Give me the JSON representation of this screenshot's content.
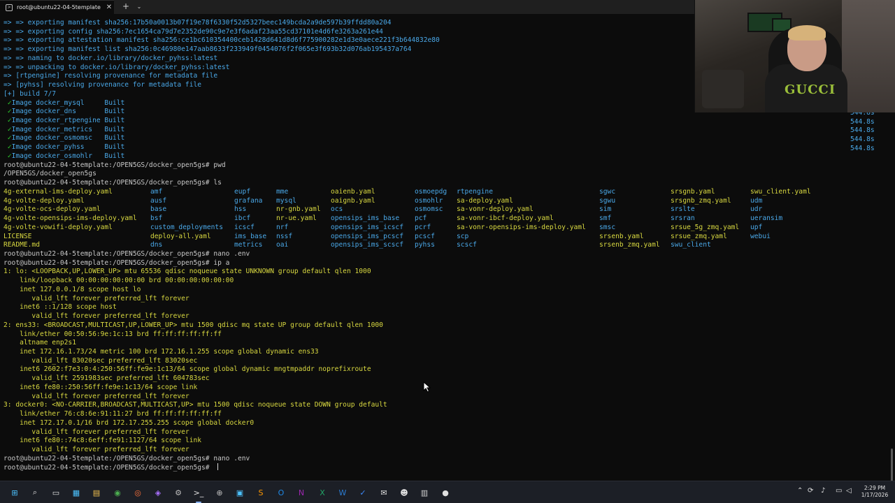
{
  "window": {
    "tab_title": "root@ubuntu22-04-5template",
    "tab_icon": "terminal-icon",
    "close_glyph": "✕",
    "new_tab_glyph": "+",
    "dropdown_glyph": "⌄"
  },
  "colors": {
    "background": "#0c0c0c",
    "text": "#c8c8c8",
    "blue": "#4aa8e8",
    "green": "#1cc41c",
    "yellow": "#d8d840"
  },
  "build_output": [
    {
      "arrow": "=> => ",
      "text": "exporting manifest sha256:17b50a0013b07f19e78f6330f52d5327beec149bcda2a9de597b39ffdd80a204"
    },
    {
      "arrow": "=> => ",
      "text": "exporting config sha256:7ec1654ca79d7e2352de90c9e7e3f6adaf23aa55cd37101e4d6fe3263a261e44"
    },
    {
      "arrow": "=> => ",
      "text": "exporting attestation manifest sha256:ce1bc610354400ceb1428d641d8d6f775900282e1d3e0aece221f3b644832e80"
    },
    {
      "arrow": "=> => ",
      "text": "exporting manifest list sha256:0c46980e147aab8633f233949f0454076f2f065e3f693b32d076ab195437a764"
    },
    {
      "arrow": "=> => ",
      "text": "naming to docker.io/library/docker_pyhss:latest"
    },
    {
      "arrow": "=> => ",
      "text": "unpacking to docker.io/library/docker_pyhss:latest"
    },
    {
      "arrow": "=> ",
      "text": "[rtpengine] resolving provenance for metadata file"
    },
    {
      "arrow": "=> ",
      "text": "[pyhss] resolving provenance for metadata file"
    }
  ],
  "build_summary": "[+] build 7/7",
  "images": [
    {
      "name": "Image docker_mysql",
      "status": "Built"
    },
    {
      "name": "Image docker_dns",
      "status": "Built"
    },
    {
      "name": "Image docker_rtpengine",
      "status": "Built"
    },
    {
      "name": "Image docker_metrics",
      "status": "Built"
    },
    {
      "name": "Image docker_osmomsc",
      "status": "Built"
    },
    {
      "name": "Image docker_pyhss",
      "status": "Built"
    },
    {
      "name": "Image docker_osmohlr",
      "status": "Built"
    }
  ],
  "check_glyph": "✓",
  "build_times": [
    "544.8s",
    "544.8s",
    "544.8s",
    "544.8s",
    "544.8s",
    "544.8s",
    "544.8s"
  ],
  "prompt": "root@ubuntu22-04-5template:/OPEN5GS/docker_open5gs#",
  "commands": {
    "pwd": "pwd",
    "pwd_output": "/OPEN5GS/docker_open5gs",
    "ls": "ls",
    "nano1": "nano .env",
    "ip": "ip a",
    "nano2": "nano .env"
  },
  "ls_output": [
    {
      "text": "4g-external-ims-deploy.yaml",
      "color": "c-y",
      "col": 0,
      "row": 0
    },
    {
      "text": "4g-volte-deploy.yaml",
      "color": "c-y",
      "col": 0,
      "row": 1
    },
    {
      "text": "4g-volte-ocs-deploy.yaml",
      "color": "c-y",
      "col": 0,
      "row": 2
    },
    {
      "text": "4g-volte-opensips-ims-deploy.yaml",
      "color": "c-y",
      "col": 0,
      "row": 3
    },
    {
      "text": "4g-volte-vowifi-deploy.yaml",
      "color": "c-y",
      "col": 0,
      "row": 4
    },
    {
      "text": "LICENSE",
      "color": "c-y",
      "col": 0,
      "row": 5
    },
    {
      "text": "README.md",
      "color": "c-y",
      "col": 0,
      "row": 6
    },
    {
      "text": "amf",
      "color": "c-b",
      "col": 1,
      "row": 0
    },
    {
      "text": "ausf",
      "color": "c-b",
      "col": 1,
      "row": 1
    },
    {
      "text": "base",
      "color": "c-b",
      "col": 1,
      "row": 2
    },
    {
      "text": "bsf",
      "color": "c-b",
      "col": 1,
      "row": 3
    },
    {
      "text": "custom_deployments",
      "color": "c-b",
      "col": 1,
      "row": 4
    },
    {
      "text": "deploy-all.yaml",
      "color": "c-y",
      "col": 1,
      "row": 5
    },
    {
      "text": "dns",
      "color": "c-b",
      "col": 1,
      "row": 6
    },
    {
      "text": "eupf",
      "color": "c-b",
      "col": 2,
      "row": 0
    },
    {
      "text": "grafana",
      "color": "c-b",
      "col": 2,
      "row": 1
    },
    {
      "text": "hss",
      "color": "c-b",
      "col": 2,
      "row": 2
    },
    {
      "text": "ibcf",
      "color": "c-b",
      "col": 2,
      "row": 3
    },
    {
      "text": "icscf",
      "color": "c-b",
      "col": 2,
      "row": 4
    },
    {
      "text": "ims_base",
      "color": "c-b",
      "col": 2,
      "row": 5
    },
    {
      "text": "metrics",
      "color": "c-b",
      "col": 2,
      "row": 6
    },
    {
      "text": "mme",
      "color": "c-b",
      "col": 3,
      "row": 0
    },
    {
      "text": "mysql",
      "color": "c-b",
      "col": 3,
      "row": 1
    },
    {
      "text": "nr-gnb.yaml",
      "color": "c-y",
      "col": 3,
      "row": 2
    },
    {
      "text": "nr-ue.yaml",
      "color": "c-y",
      "col": 3,
      "row": 3
    },
    {
      "text": "nrf",
      "color": "c-b",
      "col": 3,
      "row": 4
    },
    {
      "text": "nssf",
      "color": "c-b",
      "col": 3,
      "row": 5
    },
    {
      "text": "oai",
      "color": "c-b",
      "col": 3,
      "row": 6
    },
    {
      "text": "oaienb.yaml",
      "color": "c-y",
      "col": 4,
      "row": 0
    },
    {
      "text": "oaignb.yaml",
      "color": "c-y",
      "col": 4,
      "row": 1
    },
    {
      "text": "ocs",
      "color": "c-b",
      "col": 4,
      "row": 2
    },
    {
      "text": "opensips_ims_base",
      "color": "c-b",
      "col": 4,
      "row": 3
    },
    {
      "text": "opensips_ims_icscf",
      "color": "c-b",
      "col": 4,
      "row": 4
    },
    {
      "text": "opensips_ims_pcscf",
      "color": "c-b",
      "col": 4,
      "row": 5
    },
    {
      "text": "opensips_ims_scscf",
      "color": "c-b",
      "col": 4,
      "row": 6
    },
    {
      "text": "osmoepdg",
      "color": "c-b",
      "col": 5,
      "row": 0
    },
    {
      "text": "osmohlr",
      "color": "c-b",
      "col": 5,
      "row": 1
    },
    {
      "text": "osmomsc",
      "color": "c-b",
      "col": 5,
      "row": 2
    },
    {
      "text": "pcf",
      "color": "c-b",
      "col": 5,
      "row": 3
    },
    {
      "text": "pcrf",
      "color": "c-b",
      "col": 5,
      "row": 4
    },
    {
      "text": "pcscf",
      "color": "c-b",
      "col": 5,
      "row": 5
    },
    {
      "text": "pyhss",
      "color": "c-b",
      "col": 5,
      "row": 6
    },
    {
      "text": "rtpengine",
      "color": "c-b",
      "col": 6,
      "row": 0
    },
    {
      "text": "sa-deploy.yaml",
      "color": "c-y",
      "col": 6,
      "row": 1
    },
    {
      "text": "sa-vonr-deploy.yaml",
      "color": "c-y",
      "col": 6,
      "row": 2
    },
    {
      "text": "sa-vonr-ibcf-deploy.yaml",
      "color": "c-y",
      "col": 6,
      "row": 3
    },
    {
      "text": "sa-vonr-opensips-ims-deploy.yaml",
      "color": "c-y",
      "col": 6,
      "row": 4
    },
    {
      "text": "scp",
      "color": "c-b",
      "col": 6,
      "row": 5
    },
    {
      "text": "scscf",
      "color": "c-b",
      "col": 6,
      "row": 6
    },
    {
      "text": "sgwc",
      "color": "c-b",
      "col": 7,
      "row": 0
    },
    {
      "text": "sgwu",
      "color": "c-b",
      "col": 7,
      "row": 1
    },
    {
      "text": "sim",
      "color": "c-b",
      "col": 7,
      "row": 2
    },
    {
      "text": "smf",
      "color": "c-b",
      "col": 7,
      "row": 3
    },
    {
      "text": "smsc",
      "color": "c-b",
      "col": 7,
      "row": 4
    },
    {
      "text": "srsenb.yaml",
      "color": "c-y",
      "col": 7,
      "row": 5
    },
    {
      "text": "srsenb_zmq.yaml",
      "color": "c-y",
      "col": 7,
      "row": 6
    },
    {
      "text": "srsgnb.yaml",
      "color": "c-y",
      "col": 8,
      "row": 0
    },
    {
      "text": "srsgnb_zmq.yaml",
      "color": "c-y",
      "col": 8,
      "row": 1
    },
    {
      "text": "srslte",
      "color": "c-b",
      "col": 8,
      "row": 2
    },
    {
      "text": "srsran",
      "color": "c-b",
      "col": 8,
      "row": 3
    },
    {
      "text": "srsue_5g_zmq.yaml",
      "color": "c-y",
      "col": 8,
      "row": 4
    },
    {
      "text": "srsue_zmq.yaml",
      "color": "c-y",
      "col": 8,
      "row": 5
    },
    {
      "text": "swu_client",
      "color": "c-b",
      "col": 8,
      "row": 6
    },
    {
      "text": "swu_client.yaml",
      "color": "c-y",
      "col": 9,
      "row": 0
    },
    {
      "text": "udm",
      "color": "c-b",
      "col": 9,
      "row": 1
    },
    {
      "text": "udr",
      "color": "c-b",
      "col": 9,
      "row": 2
    },
    {
      "text": "ueransim",
      "color": "c-b",
      "col": 9,
      "row": 3
    },
    {
      "text": "upf",
      "color": "c-b",
      "col": 9,
      "row": 4
    },
    {
      "text": "webui",
      "color": "c-b",
      "col": 9,
      "row": 5
    }
  ],
  "ip_output": [
    "1: lo: <LOOPBACK,UP,LOWER_UP> mtu 65536 qdisc noqueue state UNKNOWN group default qlen 1000",
    "    link/loopback 00:00:00:00:00:00 brd 00:00:00:00:00:00",
    "    inet 127.0.0.1/8 scope host lo",
    "       valid_lft forever preferred_lft forever",
    "    inet6 ::1/128 scope host",
    "       valid_lft forever preferred_lft forever",
    "2: ens33: <BROADCAST,MULTICAST,UP,LOWER_UP> mtu 1500 qdisc mq state UP group default qlen 1000",
    "    link/ether 00:50:56:9e:1c:13 brd ff:ff:ff:ff:ff:ff",
    "    altname enp2s1",
    "    inet 172.16.1.73/24 metric 100 brd 172.16.1.255 scope global dynamic ens33",
    "       valid_lft 83020sec preferred_lft 83020sec",
    "    inet6 2602:f7e3:0:4:250:56ff:fe9e:1c13/64 scope global dynamic mngtmpaddr noprefixroute",
    "       valid_lft 2591983sec preferred_lft 604783sec",
    "    inet6 fe80::250:56ff:fe9e:1c13/64 scope link",
    "       valid_lft forever preferred_lft forever",
    "3: docker0: <NO-CARRIER,BROADCAST,MULTICAST,UP> mtu 1500 qdisc noqueue state DOWN group default",
    "    link/ether 76:c8:6e:91:11:27 brd ff:ff:ff:ff:ff:ff",
    "    inet 172.17.0.1/16 brd 172.17.255.255 scope global docker0",
    "       valid_lft forever preferred_lft forever",
    "    inet6 fe80::74c8:6eff:fe91:1127/64 scope link",
    "       valid_lft forever preferred_lft forever"
  ],
  "webcam": {
    "shirt_text": "GUCCI"
  },
  "taskbar": {
    "apps": [
      {
        "name": "windows-start-icon",
        "glyph": "⊞"
      },
      {
        "name": "search-icon",
        "glyph": "⌕"
      },
      {
        "name": "task-view-icon",
        "glyph": "▭"
      },
      {
        "name": "widgets-icon",
        "glyph": "▦"
      },
      {
        "name": "file-explorer-icon",
        "glyph": "▤"
      },
      {
        "name": "chrome-icon",
        "glyph": "◉"
      },
      {
        "name": "firefox-icon",
        "glyph": "◎"
      },
      {
        "name": "vs-icon",
        "glyph": "◈"
      },
      {
        "name": "settings-icon",
        "glyph": "⚙"
      },
      {
        "name": "terminal-app-icon",
        "glyph": ">_"
      },
      {
        "name": "network-tool-icon",
        "glyph": "⊕"
      },
      {
        "name": "window-icon",
        "glyph": "▣"
      },
      {
        "name": "sublime-icon",
        "glyph": "S"
      },
      {
        "name": "outlook-icon",
        "glyph": "O"
      },
      {
        "name": "onenote-icon",
        "glyph": "N"
      },
      {
        "name": "excel-icon",
        "glyph": "X"
      },
      {
        "name": "word-icon",
        "glyph": "W"
      },
      {
        "name": "todo-icon",
        "glyph": "✓"
      },
      {
        "name": "mail-icon",
        "glyph": "✉"
      },
      {
        "name": "teams-icon",
        "glyph": "☻"
      },
      {
        "name": "notepad-icon",
        "glyph": "▥"
      },
      {
        "name": "obs-icon",
        "glyph": "●"
      }
    ],
    "tray": [
      {
        "name": "chevron-up-icon",
        "glyph": "⌃"
      },
      {
        "name": "sync-icon",
        "glyph": "⟳"
      },
      {
        "name": "mic-icon",
        "glyph": "♪"
      },
      {
        "name": "display-icon",
        "glyph": "▭"
      },
      {
        "name": "speaker-icon",
        "glyph": "◁"
      },
      {
        "name": "notification-icon",
        "glyph": "☐"
      }
    ],
    "time": "2:29 PM",
    "date": "1/17/2026"
  }
}
